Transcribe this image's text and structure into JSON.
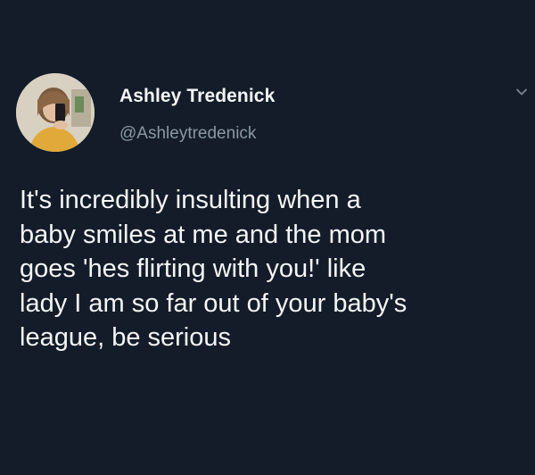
{
  "tweet": {
    "author_name": "Ashley Tredenick",
    "author_handle": "@Ashleytredenick",
    "text": "It's incredibly insulting when a\nbaby smiles at me and the mom\ngoes 'hes flirting with you!' like\nlady I am so far out of your baby's\nleague, be serious"
  },
  "colors": {
    "background": "#141c29",
    "text_primary": "#f4f6f8",
    "text_secondary": "#8a97a4"
  },
  "icons": {
    "avatar": "profile-photo",
    "menu": "chevron-down-icon"
  }
}
